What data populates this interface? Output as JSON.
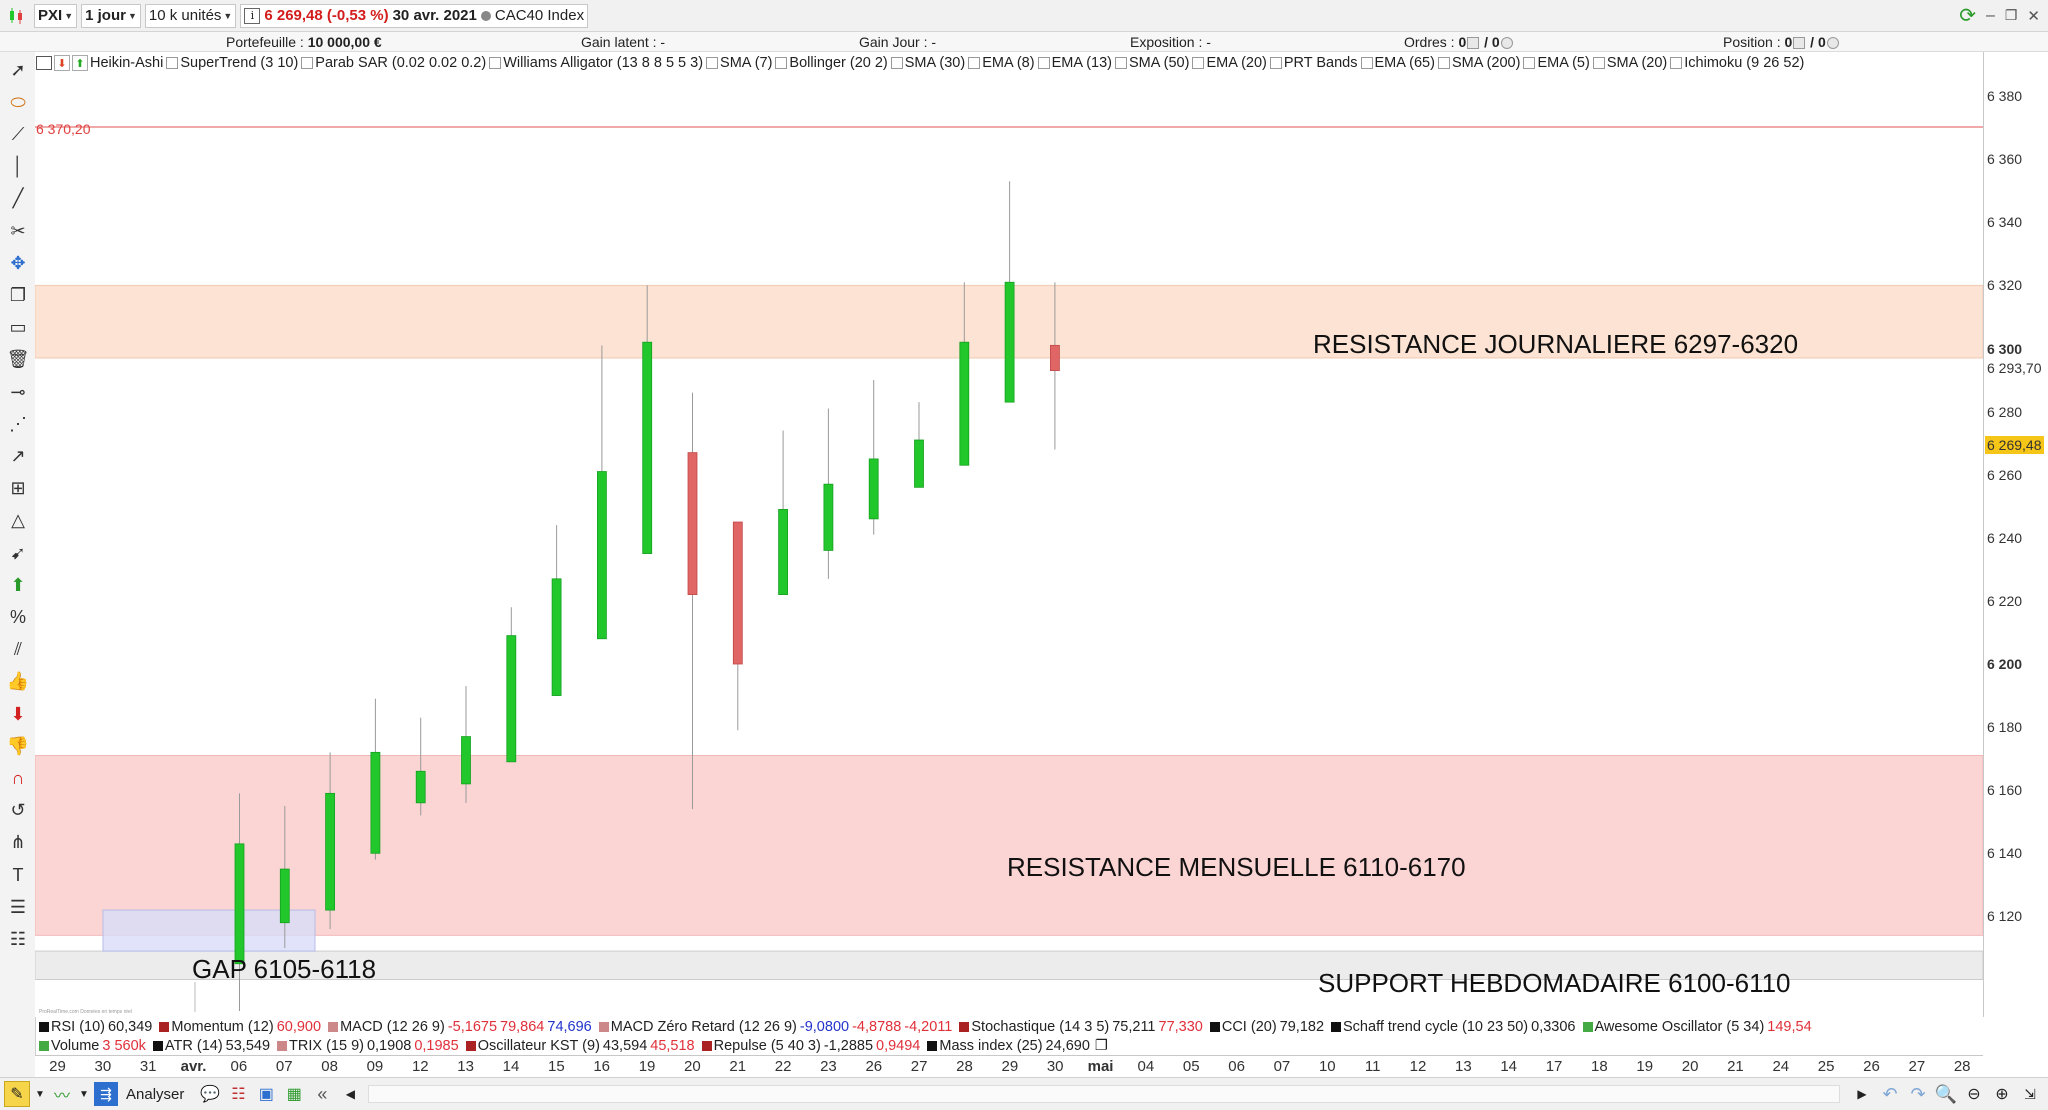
{
  "toolbar": {
    "instrument": "PXI",
    "timeframe": "1 jour",
    "units": "10 k unités",
    "info_icon": "i",
    "last_price": "6 269,48 (-0,53 %)",
    "date": "30 avr. 2021",
    "index_name": "CAC40 Index"
  },
  "infobar": {
    "portefeuille_label": "Portefeuille :",
    "portefeuille_value": "10 000,00 €",
    "gain_latent": "Gain latent : -",
    "gain_jour": "Gain Jour : -",
    "exposition": "Exposition : -",
    "ordres_label": "Ordres :",
    "ordres_value": "0",
    "ordres_value2": "/ 0",
    "position_label": "Position :",
    "position_value": "0",
    "position_value2": "/ 0"
  },
  "indicators_top": [
    "Heikin-Ashi",
    "SuperTrend (3 10)",
    "Parab SAR (0.02 0.02 0.2)",
    "Williams Alligator (13 8 8 5 5 3)",
    "SMA (7)",
    "Bollinger (20 2)",
    "SMA (30)",
    "EMA (8)",
    "EMA (13)",
    "SMA (50)",
    "EMA (20)",
    "PRT Bands",
    "EMA (65)",
    "SMA (200)",
    "EMA (5)",
    "SMA (20)",
    "Ichimoku (9 26 52)"
  ],
  "colors": {
    "bull": "#21c72b",
    "bear": "#e06666",
    "resistance_daily": "#fde3d3",
    "resistance_monthly": "#fbd4d4",
    "support_weekly": "#ececec",
    "gap": "#d8dcf7",
    "line_level": "#e05050",
    "last_price_badge": "#f5c518"
  },
  "chart": {
    "level_label": "6 370,20",
    "zones": {
      "daily": "RESISTANCE JOURNALIERE 6297-6320",
      "monthly": "RESISTANCE MENSUELLE 6110-6170",
      "weekly": "SUPPORT HEBDOMADAIRE 6100-6110",
      "gap": "GAP 6105-6118"
    },
    "yaxis": [
      "6 380",
      "6 360",
      "6 340",
      "6 320",
      "6 300",
      "6 280",
      "6 260",
      "6 240",
      "6 220",
      "6 200",
      "6 180",
      "6 160",
      "6 140",
      "6 120"
    ],
    "yaxis_highlight": "6 293,70",
    "last_price_tag": "6 269,48",
    "watermark": "ProRealTime.com Données en temps réel"
  },
  "chart_data": {
    "type": "candlestick",
    "ohlc": [
      {
        "date": "06 avr.",
        "open": 6105,
        "high": 6159,
        "low": 6090,
        "close": 6143
      },
      {
        "date": "07 avr.",
        "open": 6118,
        "high": 6155,
        "low": 6110,
        "close": 6135
      },
      {
        "date": "08 avr.",
        "open": 6122,
        "high": 6172,
        "low": 6116,
        "close": 6159
      },
      {
        "date": "09 avr.",
        "open": 6140,
        "high": 6189,
        "low": 6138,
        "close": 6172
      },
      {
        "date": "12 avr.",
        "open": 6156,
        "high": 6183,
        "low": 6152,
        "close": 6166
      },
      {
        "date": "13 avr.",
        "open": 6162,
        "high": 6193,
        "low": 6156,
        "close": 6177
      },
      {
        "date": "14 avr.",
        "open": 6169,
        "high": 6218,
        "low": 6169,
        "close": 6209
      },
      {
        "date": "15 avr.",
        "open": 6190,
        "high": 6244,
        "low": 6190,
        "close": 6227
      },
      {
        "date": "16 avr.",
        "open": 6208,
        "high": 6301,
        "low": 6208,
        "close": 6261
      },
      {
        "date": "19 avr.",
        "open": 6235,
        "high": 6320,
        "low": 6235,
        "close": 6302
      },
      {
        "date": "20 avr.",
        "open": 6267,
        "high": 6286,
        "low": 6154,
        "close": 6222
      },
      {
        "date": "21 avr.",
        "open": 6245,
        "high": 6245,
        "low": 6179,
        "close": 6200
      },
      {
        "date": "22 avr.",
        "open": 6222,
        "high": 6274,
        "low": 6222,
        "close": 6249
      },
      {
        "date": "23 avr.",
        "open": 6236,
        "high": 6281,
        "low": 6227,
        "close": 6257
      },
      {
        "date": "26 avr.",
        "open": 6246,
        "high": 6290,
        "low": 6241,
        "close": 6265
      },
      {
        "date": "27 avr.",
        "open": 6256,
        "high": 6283,
        "low": 6256,
        "close": 6271
      },
      {
        "date": "28 avr.",
        "open": 6263,
        "high": 6321,
        "low": 6263,
        "close": 6302
      },
      {
        "date": "29 avr.",
        "open": 6283,
        "high": 6353,
        "low": 6283,
        "close": 6321
      },
      {
        "date": "30 avr.",
        "open": 6301,
        "high": 6321,
        "low": 6268,
        "close": 6293
      }
    ],
    "ylim": [
      6096,
      6392
    ],
    "level_line": 6370.2,
    "zones": [
      {
        "name": "RESISTANCE JOURNALIERE 6297-6320",
        "low": 6297,
        "high": 6320
      },
      {
        "name": "RESISTANCE MENSUELLE 6110-6170",
        "low": 6114,
        "high": 6171
      },
      {
        "name": "SUPPORT HEBDOMADAIRE 6100-6110",
        "low": 6100,
        "high": 6109
      },
      {
        "name": "GAP 6105-6118",
        "low": 6109,
        "high": 6122
      }
    ]
  },
  "indicators_bottom_row1": [
    {
      "name": "RSI (10)",
      "values": [
        {
          "v": "60,349",
          "c": "n"
        }
      ],
      "color": "#111111"
    },
    {
      "name": "Momentum (12)",
      "values": [
        {
          "v": "60,900",
          "c": "r"
        }
      ],
      "color": "#aa2222"
    },
    {
      "name": "MACD (12 26 9)",
      "values": [
        {
          "v": "-5,1675",
          "c": "r"
        },
        {
          "v": "79,864",
          "c": "r"
        },
        {
          "v": "74,696",
          "c": "b"
        }
      ],
      "color": "#cc8888"
    },
    {
      "name": "MACD Zéro Retard (12 26 9)",
      "values": [
        {
          "v": "-9,0800",
          "c": "b"
        },
        {
          "v": "-4,8788",
          "c": "r"
        },
        {
          "v": "-4,2011",
          "c": "r"
        }
      ],
      "color": "#cc8888"
    },
    {
      "name": "Stochastique (14 3 5)",
      "values": [
        {
          "v": "75,211",
          "c": "n"
        },
        {
          "v": "77,330",
          "c": "r"
        }
      ],
      "color": "#aa2222"
    },
    {
      "name": "CCI (20)",
      "values": [
        {
          "v": "79,182",
          "c": "n"
        }
      ],
      "color": "#111111"
    },
    {
      "name": "Schaff trend cycle (10 23 50)",
      "values": [
        {
          "v": "0,3306",
          "c": "n"
        }
      ],
      "color": "#111111"
    },
    {
      "name": "Awesome Oscillator (5 34)",
      "values": [
        {
          "v": "149,54",
          "c": "r"
        }
      ],
      "color": "#44aa44"
    }
  ],
  "indicators_bottom_row2": [
    {
      "name": "Volume",
      "values": [
        {
          "v": "3 560k",
          "c": "r"
        }
      ],
      "color": "#44aa44"
    },
    {
      "name": "ATR (14)",
      "values": [
        {
          "v": "53,549",
          "c": "n"
        }
      ],
      "color": "#111111"
    },
    {
      "name": "TRIX (15 9)",
      "values": [
        {
          "v": "0,1908",
          "c": "n"
        },
        {
          "v": "0,1985",
          "c": "r"
        }
      ],
      "color": "#cc8888"
    },
    {
      "name": "Oscillateur KST (9)",
      "values": [
        {
          "v": "43,594",
          "c": "n"
        },
        {
          "v": "45,518",
          "c": "r"
        }
      ],
      "color": "#aa2222"
    },
    {
      "name": "Repulse (5 40 3)",
      "values": [
        {
          "v": "-1,2885",
          "c": "n"
        },
        {
          "v": "0,9494",
          "c": "r"
        }
      ],
      "color": "#aa2222"
    },
    {
      "name": "Mass index (25)",
      "values": [
        {
          "v": "24,690",
          "c": "n"
        }
      ],
      "color": "#111111"
    }
  ],
  "xaxis": [
    {
      "label": "29",
      "bold": false
    },
    {
      "label": "30",
      "bold": false
    },
    {
      "label": "31",
      "bold": false
    },
    {
      "label": "avr.",
      "bold": true
    },
    {
      "label": "06",
      "bold": false
    },
    {
      "label": "07",
      "bold": false
    },
    {
      "label": "08",
      "bold": false
    },
    {
      "label": "09",
      "bold": false
    },
    {
      "label": "12",
      "bold": false
    },
    {
      "label": "13",
      "bold": false
    },
    {
      "label": "14",
      "bold": false
    },
    {
      "label": "15",
      "bold": false
    },
    {
      "label": "16",
      "bold": false
    },
    {
      "label": "19",
      "bold": false
    },
    {
      "label": "20",
      "bold": false
    },
    {
      "label": "21",
      "bold": false
    },
    {
      "label": "22",
      "bold": false
    },
    {
      "label": "23",
      "bold": false
    },
    {
      "label": "26",
      "bold": false
    },
    {
      "label": "27",
      "bold": false
    },
    {
      "label": "28",
      "bold": false
    },
    {
      "label": "29",
      "bold": false
    },
    {
      "label": "30",
      "bold": false
    },
    {
      "label": "mai",
      "bold": true
    },
    {
      "label": "04",
      "bold": false
    },
    {
      "label": "05",
      "bold": false
    },
    {
      "label": "06",
      "bold": false
    },
    {
      "label": "07",
      "bold": false
    },
    {
      "label": "10",
      "bold": false
    },
    {
      "label": "11",
      "bold": false
    },
    {
      "label": "12",
      "bold": false
    },
    {
      "label": "13",
      "bold": false
    },
    {
      "label": "14",
      "bold": false
    },
    {
      "label": "17",
      "bold": false
    },
    {
      "label": "18",
      "bold": false
    },
    {
      "label": "19",
      "bold": false
    },
    {
      "label": "20",
      "bold": false
    },
    {
      "label": "21",
      "bold": false
    },
    {
      "label": "24",
      "bold": false
    },
    {
      "label": "25",
      "bold": false
    },
    {
      "label": "26",
      "bold": false
    },
    {
      "label": "27",
      "bold": false
    },
    {
      "label": "28",
      "bold": false
    }
  ],
  "bottombar": {
    "analyser_label": "Analyser"
  },
  "icons": {
    "left_tools": [
      "pointer-icon",
      "ellipse-icon",
      "segment-icon",
      "vertical-line-icon",
      "trend-line-icon",
      "crosshair-magnet-icon",
      "move-icon",
      "copy-icon",
      "rectangle-icon",
      "trash-icon",
      "horizontal-line-icon",
      "fan-icon",
      "ray-icon",
      "fibonacci-icon",
      "triangle-icon",
      "arrow-icon",
      "up-arrow-icon",
      "percent-icon",
      "channel-icon",
      "thumb-up-icon",
      "down-arrow-icon",
      "thumb-down-icon",
      "magnet-icon",
      "rotate-icon",
      "pitchfork-icon",
      "text-icon",
      "fib-retracement-icon",
      "fib-extension-icon"
    ]
  }
}
